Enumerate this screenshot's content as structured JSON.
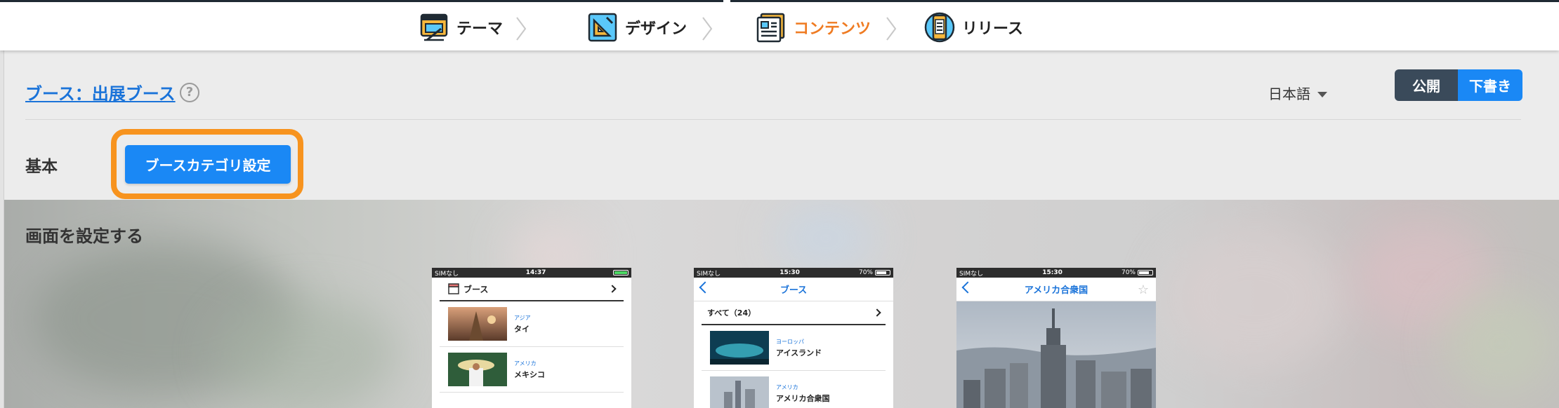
{
  "steps": [
    {
      "label": "テーマ",
      "icon": "theme-icon",
      "active": false
    },
    {
      "label": "デザイン",
      "icon": "design-icon",
      "active": false
    },
    {
      "label": "コンテンツ",
      "icon": "contents-icon",
      "active": true
    },
    {
      "label": "リリース",
      "icon": "release-icon",
      "active": false
    }
  ],
  "header": {
    "page_title": "ブース：出展ブース",
    "help_icon": "?",
    "language": "日本語",
    "publish_label": "公開",
    "draft_label": "下書き"
  },
  "basic": {
    "label": "基本",
    "category_button": "ブースカテゴリ設定"
  },
  "screens": {
    "title": "画面を設定する",
    "phone1": {
      "carrier": "SIMなし",
      "time": "14:37",
      "header": "ブース",
      "items": [
        {
          "tag": "アジア",
          "name": "タイ"
        },
        {
          "tag": "アメリカ",
          "name": "メキシコ"
        }
      ]
    },
    "phone2": {
      "carrier": "SIMなし",
      "time": "15:30",
      "battery": "70%",
      "title": "ブース",
      "all_label": "すべて（24）",
      "items": [
        {
          "tag": "ヨーロッパ",
          "name": "アイスランド"
        },
        {
          "tag": "アメリカ",
          "name": "アメリカ合衆国"
        }
      ]
    },
    "phone3": {
      "carrier": "SIMなし",
      "time": "15:30",
      "battery": "70%",
      "title": "アメリカ合衆国"
    }
  },
  "colors": {
    "accent_blue": "#1a88f5",
    "active_orange": "#ef7b22",
    "highlight_orange": "#f7931e",
    "publish_dark": "#3a4a5a"
  }
}
